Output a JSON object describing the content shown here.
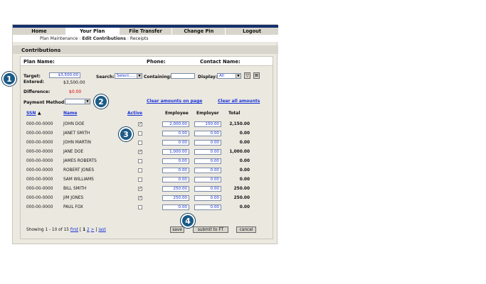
{
  "tabs": [
    {
      "label": "Home",
      "active": false
    },
    {
      "label": "Your Plan",
      "active": true
    },
    {
      "label": "File Transfer",
      "active": false
    },
    {
      "label": "Change Pin",
      "active": false
    },
    {
      "label": "Logout",
      "active": false
    }
  ],
  "breadcrumb": {
    "item1": "Plan Maintenance",
    "separator": ":",
    "item2": "Edit Contributions",
    "item3": "Receipts"
  },
  "section_title": "Contributions",
  "info": {
    "plan_name_label": "Plan Name:",
    "phone_label": "Phone:",
    "contact_label": "Contact Name:"
  },
  "summary": {
    "target_label": "Target:",
    "target_value": "$3,500.00",
    "entered_label": "Entered:",
    "entered_value": "$3,500.00",
    "difference_label": "Difference:",
    "difference_value": "$0.00",
    "payment_label": "Payment Method:",
    "payment_value": ""
  },
  "filters": {
    "search_label": "Search:",
    "search_value": "Select.....",
    "containing_label": "Containing:",
    "containing_value": "",
    "display_label": "Display:",
    "display_value": "All",
    "filter_icon": "funnel-icon",
    "clear_filter_icon": "funnel-clear-icon"
  },
  "links": {
    "clear_page": "Clear amounts on page",
    "clear_all": "Clear all amounts"
  },
  "columns": {
    "ssn": "SSN",
    "name": "Name",
    "active": "Active",
    "employee": "Employee",
    "employer": "Employer",
    "total": "Total"
  },
  "rows": [
    {
      "ssn": "000-00-0000",
      "name": "JOHN DOE",
      "active": true,
      "employee": "2,000.00",
      "employer": "150.00",
      "total": "2,150.00"
    },
    {
      "ssn": "000-00-0000",
      "name": "JANET SMITH",
      "active": false,
      "employee": "0.00",
      "employer": "0.00",
      "total": "0.00"
    },
    {
      "ssn": "000-00-0000",
      "name": "JOHN MARTIN",
      "active": false,
      "employee": "0.00",
      "employer": "0.00",
      "total": "0.00"
    },
    {
      "ssn": "000-00-0000",
      "name": "JANE DOE",
      "active": true,
      "employee": "1,000.00",
      "employer": "0.00",
      "total": "1,000.00"
    },
    {
      "ssn": "000-00-0000",
      "name": "JAMES ROBERTS",
      "active": false,
      "employee": "0.00",
      "employer": "0.00",
      "total": "0.00"
    },
    {
      "ssn": "000-00-0000",
      "name": "ROBERT JONES",
      "active": false,
      "employee": "0.00",
      "employer": "0.00",
      "total": "0.00"
    },
    {
      "ssn": "000-00-0000",
      "name": "SAM WILLIAMS",
      "active": false,
      "employee": "0.00",
      "employer": "0.00",
      "total": "0.00"
    },
    {
      "ssn": "000-00-0000",
      "name": "BILL SMITH",
      "active": true,
      "employee": "250.00",
      "employer": "0.00",
      "total": "250.00"
    },
    {
      "ssn": "000-00-0000",
      "name": "JIM JONES",
      "active": true,
      "employee": "250.00",
      "employer": "0.00",
      "total": "250.00"
    },
    {
      "ssn": "000-00-0000",
      "name": "PAUL FOX",
      "active": false,
      "employee": "0.00",
      "employer": "0.00",
      "total": "0.00"
    }
  ],
  "footer": {
    "showing": "Showing 1 - 10 of 15",
    "first": "first",
    "bracket_open": "[",
    "page1": "1",
    "page2": "2",
    "next": ">",
    "bracket_close": "]",
    "last": "last",
    "save": "save",
    "submit": "submit to FT",
    "cancel": "cancel"
  },
  "callouts": [
    "1",
    "2",
    "3",
    "4"
  ],
  "colors": {
    "nav_bar": "#14306e",
    "link": "#1a35d8",
    "callout": "#1b5a86",
    "difference": "#d90000"
  }
}
